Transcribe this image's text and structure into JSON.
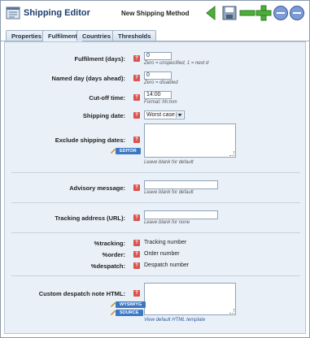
{
  "window": {
    "title": "Shipping Editor",
    "subtitle": "New Shipping Method"
  },
  "toolbar": {
    "icons": [
      "back-arrow-icon",
      "save-icon",
      "remove-icon",
      "add-icon",
      "prev-icon",
      "next-icon"
    ]
  },
  "tabs": [
    {
      "label": "Properties",
      "active": false
    },
    {
      "label": "Fulfilment",
      "active": true
    },
    {
      "label": "Countries",
      "active": false
    },
    {
      "label": "Thresholds",
      "active": false
    }
  ],
  "form": {
    "fulfilment_days": {
      "label": "Fulfilment (days):",
      "value": "0",
      "hint": "Zero = unspecified, 1 = next d"
    },
    "named_day": {
      "label": "Named day (days ahead):",
      "value": "0",
      "hint": "Zero = disabled"
    },
    "cutoff": {
      "label": "Cut-off time:",
      "value": "14:00",
      "hint": "Format: hh:mm"
    },
    "shipping_date": {
      "label": "Shipping date:",
      "value": "Worst case"
    },
    "exclude_dates": {
      "label": "Exclude shipping dates:",
      "editor_button": "EDITOR",
      "hint": "Leave blank for default"
    },
    "advisory": {
      "label": "Advisory message:",
      "hint": "Leave blank for default"
    },
    "tracking_url": {
      "label": "Tracking address (URL):",
      "hint": "Leave blank for none"
    },
    "tracking": {
      "label": "%tracking:",
      "value": "Tracking number"
    },
    "order": {
      "label": "%order:",
      "value": "Order number"
    },
    "despatch": {
      "label": "%despatch:",
      "value": "Despatch number"
    },
    "despatch_note": {
      "label": "Custom despatch note HTML:",
      "wysiwyg_button": "WYSIWYG",
      "source_button": "SOURCE",
      "link": "View default HTML template"
    }
  },
  "help_glyph": "?"
}
